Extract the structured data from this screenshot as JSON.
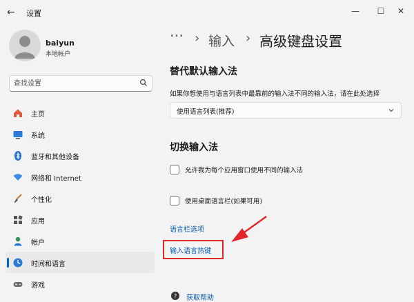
{
  "window": {
    "title": "设置",
    "back": "←",
    "minimize": "—",
    "maximize": "☐",
    "close": "✕"
  },
  "user": {
    "name": "baiyun",
    "account_type": "本地帐户"
  },
  "search": {
    "placeholder": "查找设置"
  },
  "sidebar": {
    "items": [
      {
        "label": "主页",
        "icon": "home-icon"
      },
      {
        "label": "系统",
        "icon": "system-icon"
      },
      {
        "label": "蓝牙和其他设备",
        "icon": "bluetooth-icon"
      },
      {
        "label": "网络和 Internet",
        "icon": "network-icon"
      },
      {
        "label": "个性化",
        "icon": "brush-icon"
      },
      {
        "label": "应用",
        "icon": "apps-icon"
      },
      {
        "label": "帐户",
        "icon": "account-icon"
      },
      {
        "label": "时间和语言",
        "icon": "time-language-icon",
        "active": true
      },
      {
        "label": "游戏",
        "icon": "gaming-icon"
      }
    ]
  },
  "breadcrumb": {
    "more": "···",
    "sep": "›",
    "parent": "输入",
    "current": "高级键盘设置"
  },
  "override": {
    "title": "替代默认输入法",
    "description": "如果你想使用与语言列表中最靠前的输入法不同的输入法，请在此处选择",
    "dropdown_value": "使用语言列表(推荐)"
  },
  "switching": {
    "title": "切换输入法",
    "option1": "允许我为每个应用窗口使用不同的输入法",
    "option2": "使用桌面语言栏(如果可用)",
    "option1_checked": false,
    "option2_checked": false
  },
  "links": {
    "language_bar_options": "语言栏选项",
    "input_hotkeys": "输入语言热键"
  },
  "help": {
    "label": "获取帮助"
  },
  "colors": {
    "accent": "#0067c0",
    "link": "#0b5cad",
    "annotation": "#e2262b"
  }
}
